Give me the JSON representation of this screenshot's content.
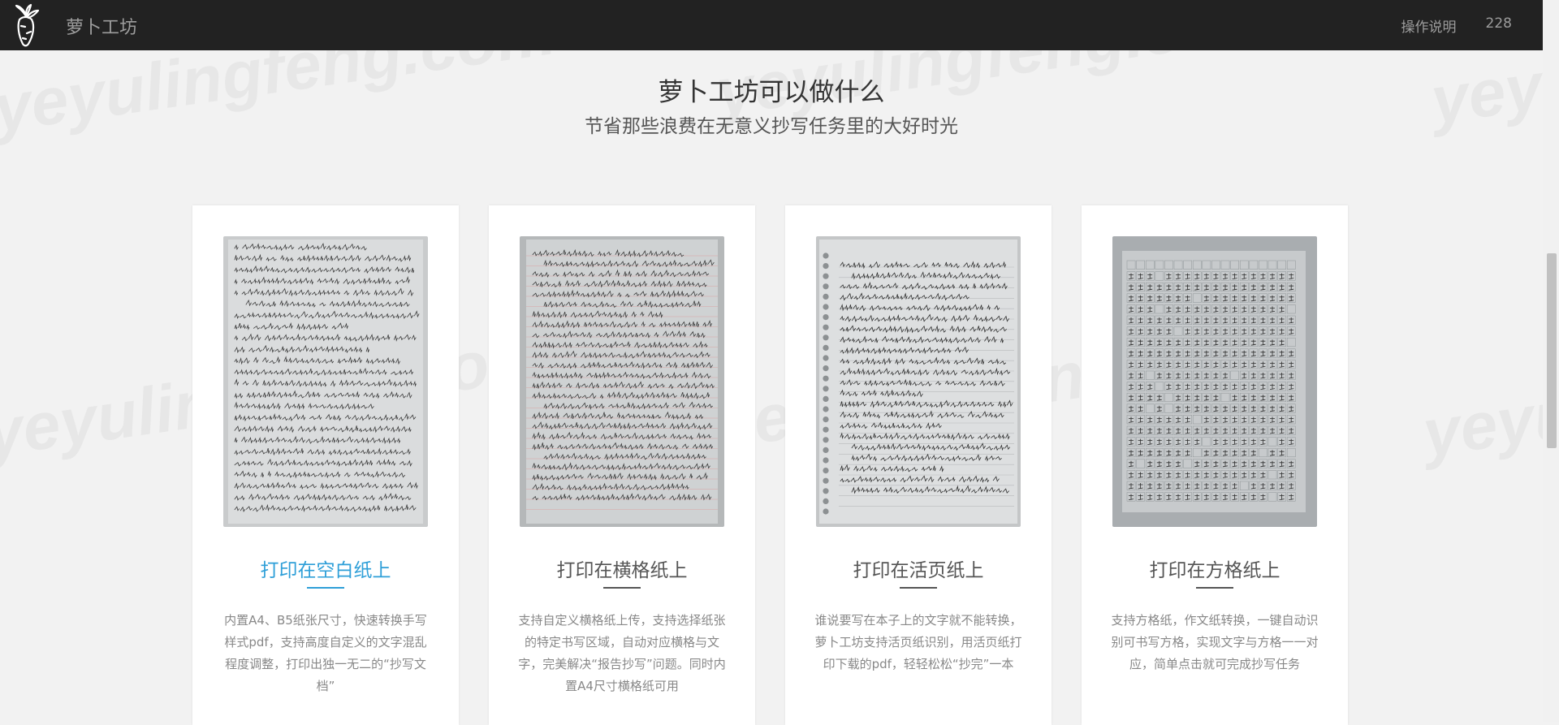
{
  "navbar": {
    "site_name": "萝卜工坊",
    "links": [
      "操作说明",
      "228"
    ]
  },
  "watermark_text": "yeyulingfeng.com",
  "hero": {
    "title": "萝卜工坊可以做什么",
    "subtitle": "节省那些浪费在无意义抄写任务里的大好时光"
  },
  "cards": [
    {
      "title": "打印在空白纸上",
      "description": "内置A4、B5纸张尺寸，快速转换手写样式pdf，支持高度自定义的文字混乱程度调整，打印出独一无二的“抄写文档”",
      "image": "handwritten-blank-paper",
      "active": true
    },
    {
      "title": "打印在横格纸上",
      "description": "支持自定义横格纸上传，支持选择纸张的特定书写区域，自动对应横格与文字，完美解决“报告抄写”问题。同时内置A4尺寸横格纸可用",
      "image": "handwritten-lined-paper",
      "active": false
    },
    {
      "title": "打印在活页纸上",
      "description": "谁说要写在本子上的文字就不能转换，萝卜工坊支持活页纸识别，用活页纸打印下载的pdf，轻轻松松“抄完”一本",
      "image": "handwritten-loose-leaf-paper",
      "active": false
    },
    {
      "title": "打印在方格纸上",
      "description": "支持方格纸，作文纸转换，一键自动识别可书写方格，实现文字与方格一一对应，简单点击就可完成抄写任务",
      "image": "handwritten-grid-paper",
      "active": false
    }
  ],
  "colors": {
    "navbar_bg": "#222222",
    "accent": "#2e9fd8",
    "page_bg": "#f2f2f2"
  }
}
